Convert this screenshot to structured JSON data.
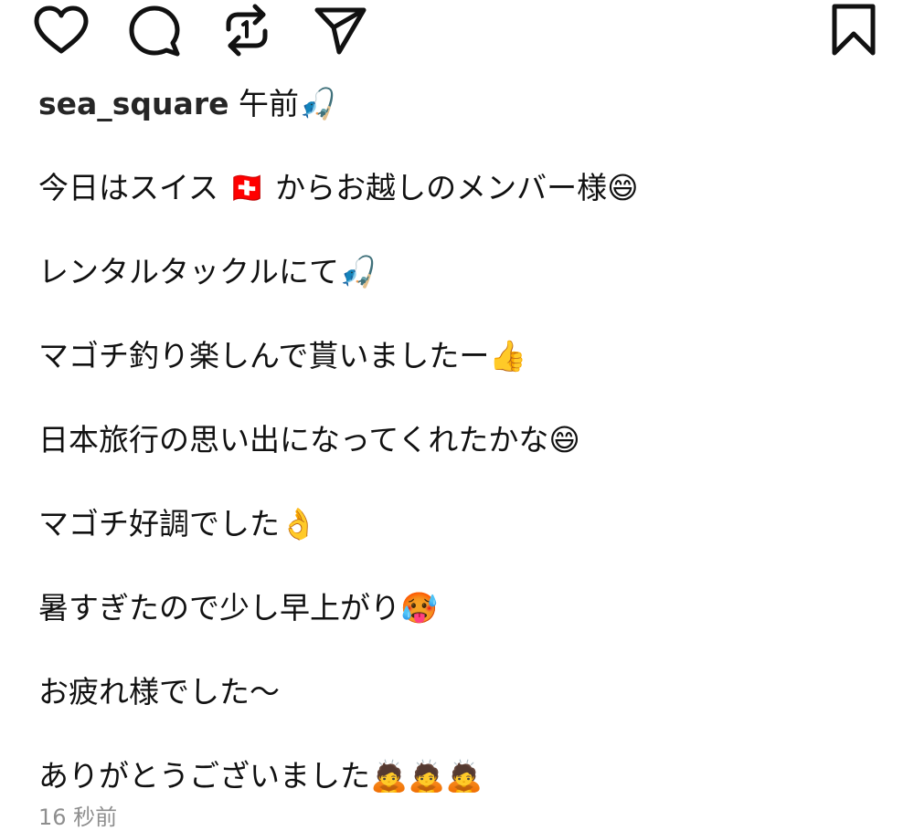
{
  "actions": {
    "like_icon": "heart-icon",
    "comment_icon": "speech-bubble-icon",
    "repost_icon": "repost-arrows-icon",
    "share_icon": "paper-plane-icon",
    "save_icon": "bookmark-icon",
    "stroke_color": "#111111"
  },
  "post": {
    "username": "sea_square",
    "caption_head": " 午前🎣",
    "lines": [
      "今日はスイス 🇨🇭 からお越しのメンバー様😄",
      "レンタルタックルにて🎣",
      "マゴチ釣り楽しんで貰いましたー👍",
      "日本旅行の思い出になってくれたかな😄",
      "マゴチ好調でした👌",
      "暑すぎたので少し早上がり🥵",
      "お疲れ様でした〜",
      "ありがとうございました🙇🙇🙇"
    ],
    "timestamp": "16 秒前",
    "username_color": "#262626",
    "timestamp_color": "#8e8e8e"
  }
}
